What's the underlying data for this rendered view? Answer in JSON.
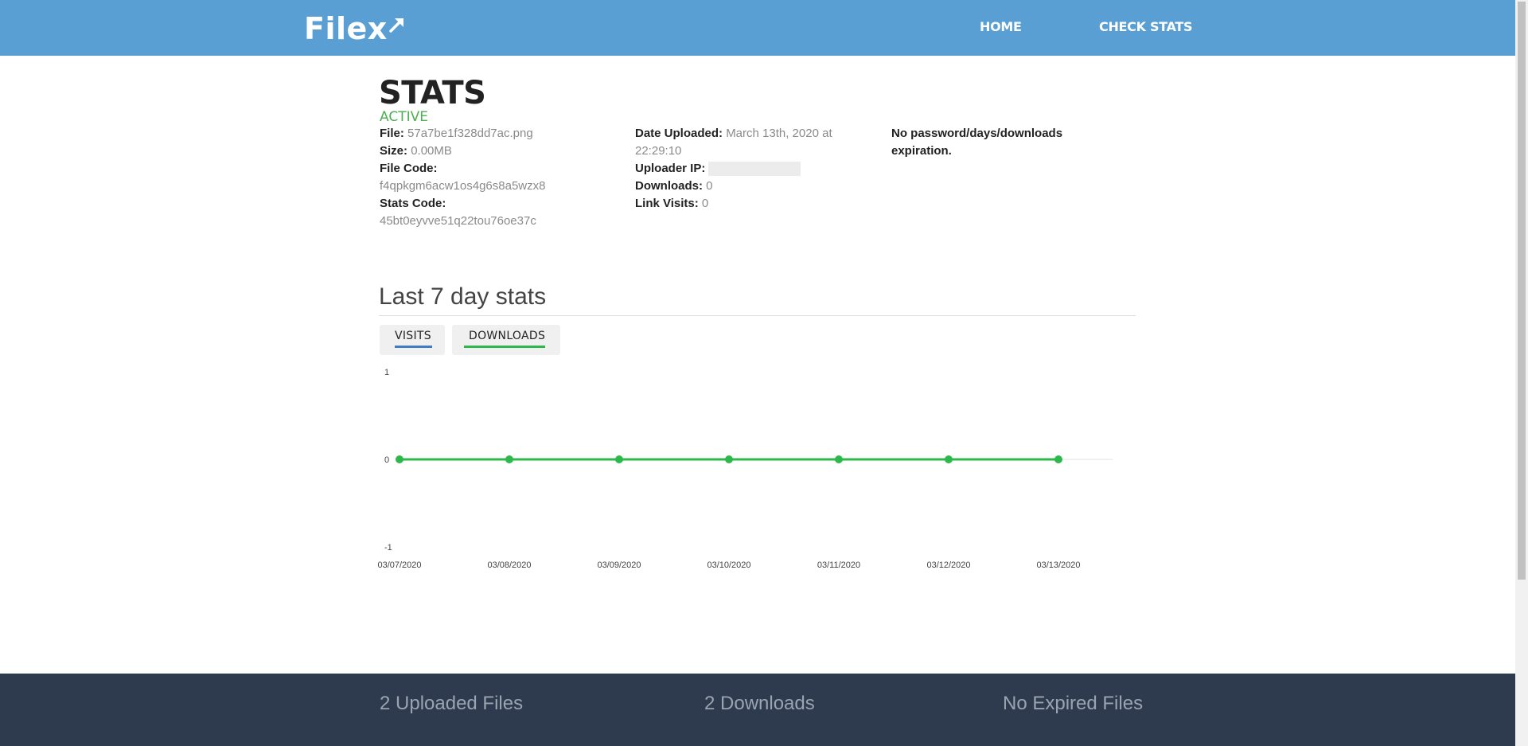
{
  "header": {
    "logo_text": "Filex",
    "nav": {
      "home": "HOME",
      "check_stats": "CHECK STATS"
    }
  },
  "stats": {
    "title": "STATS",
    "status": "ACTIVE",
    "file_label": "File:",
    "file_value": "57a7be1f328dd7ac.png",
    "size_label": "Size:",
    "size_value": "0.00MB",
    "file_code_label": "File Code:",
    "file_code_value": "f4qpkgm6acw1os4g6s8a5wzx8",
    "stats_code_label": "Stats Code:",
    "stats_code_value": "45bt0eyvve51q22tou76oe37c",
    "date_label": "Date Uploaded:",
    "date_value": "March 13th, 2020 at 22:29:10",
    "uploader_ip_label": "Uploader IP:",
    "downloads_label": "Downloads:",
    "downloads_value": "0",
    "link_visits_label": "Link Visits:",
    "link_visits_value": "0",
    "expiration_note": "No password/days/downloads expiration."
  },
  "chart_section": {
    "title": "Last 7 day stats",
    "tabs": [
      {
        "label": "VISITS",
        "color": "#3e7cc6"
      },
      {
        "label": "DOWNLOADS",
        "color": "#2db84c"
      }
    ]
  },
  "chart_data": {
    "type": "line",
    "x": [
      "03/07/2020",
      "03/08/2020",
      "03/09/2020",
      "03/10/2020",
      "03/11/2020",
      "03/12/2020",
      "03/13/2020"
    ],
    "series": [
      {
        "values": [
          0,
          0,
          0,
          0,
          0,
          0,
          0
        ],
        "color": "#2db84c"
      }
    ],
    "ylim": [
      -1,
      1
    ],
    "yticks": [
      "1",
      "0",
      "-1"
    ],
    "grid": false,
    "title": "",
    "xlabel": "",
    "ylabel": ""
  },
  "footer": {
    "uploaded": "2 Uploaded Files",
    "downloads": "2 Downloads",
    "expired": "No Expired Files"
  }
}
